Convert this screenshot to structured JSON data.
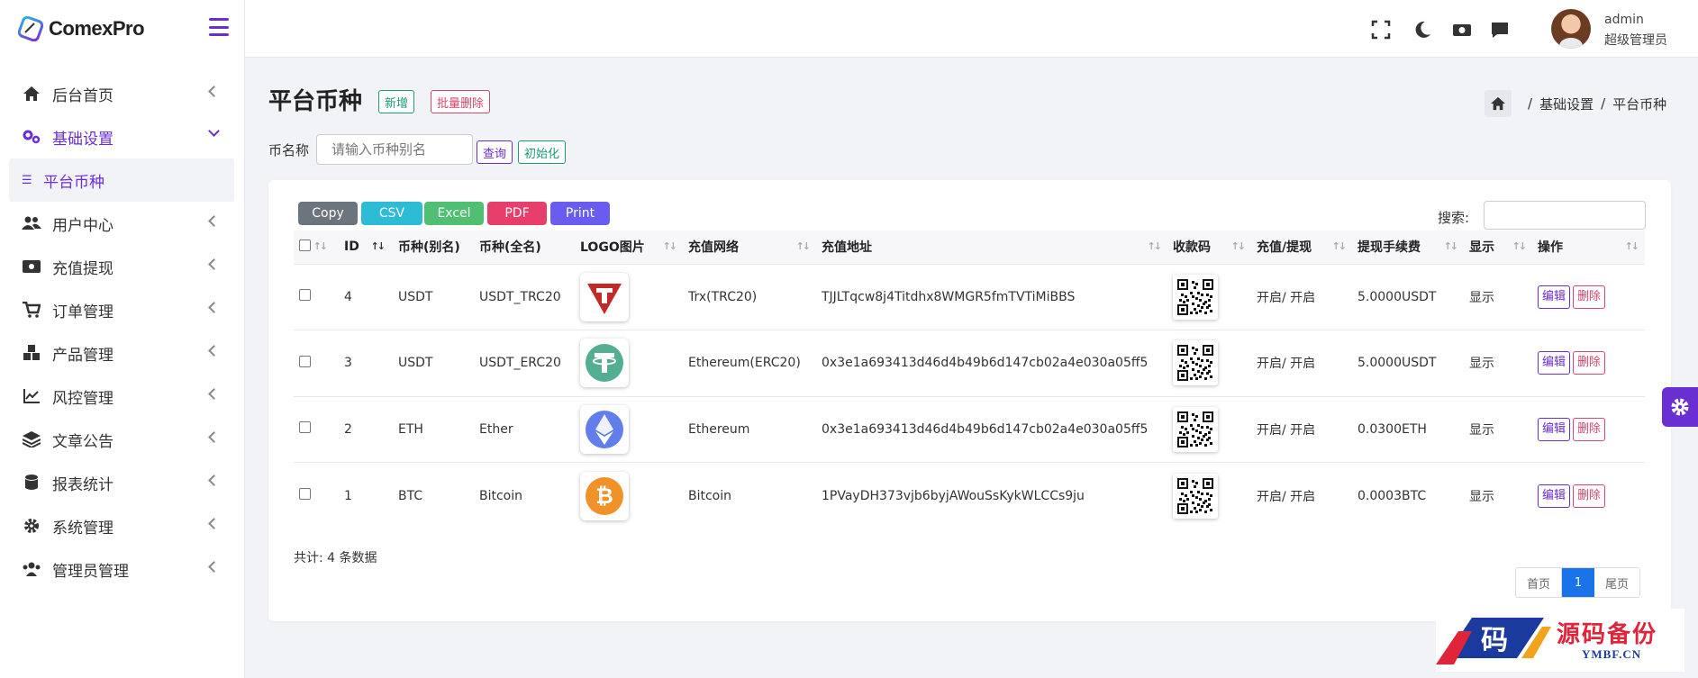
{
  "brand": {
    "name": "ComexPro"
  },
  "sidebar": {
    "items": [
      {
        "label": "后台首页",
        "icon": "home-icon"
      },
      {
        "label": "基础设置",
        "icon": "gears-icon"
      },
      {
        "label": "用户中心",
        "icon": "users-icon"
      },
      {
        "label": "充值提现",
        "icon": "money-icon"
      },
      {
        "label": "订单管理",
        "icon": "cart-icon"
      },
      {
        "label": "产品管理",
        "icon": "cubes-icon"
      },
      {
        "label": "风控管理",
        "icon": "chart-line-icon"
      },
      {
        "label": "文章公告",
        "icon": "layers-icon"
      },
      {
        "label": "报表统计",
        "icon": "database-icon"
      },
      {
        "label": "系统管理",
        "icon": "gear-icon"
      },
      {
        "label": "管理员管理",
        "icon": "user-group-icon"
      }
    ],
    "active_sub": "平台币种"
  },
  "topbar": {
    "user_name": "admin",
    "user_role": "超级管理员"
  },
  "page": {
    "title": "平台币种",
    "add_label": "新增",
    "bulk_delete_label": "批量删除",
    "breadcrumb": [
      "基础设置",
      "平台币种"
    ]
  },
  "filter": {
    "label": "币名称",
    "placeholder": "请输入币种别名",
    "search_label": "查询",
    "init_label": "初始化"
  },
  "exports": [
    {
      "label": "Copy",
      "color": "#6c757d"
    },
    {
      "label": "CSV",
      "color": "#2dbcd6"
    },
    {
      "label": "Excel",
      "color": "#4fbf72"
    },
    {
      "label": "PDF",
      "color": "#e83e6c"
    },
    {
      "label": "Print",
      "color": "#6a5cf0"
    }
  ],
  "table": {
    "search_label": "搜索:",
    "columns": [
      "ID",
      "币种(别名)",
      "币种(全名)",
      "LOGO图片",
      "充值网络",
      "充值地址",
      "收款码",
      "充值/提现",
      "提现手续费",
      "显示",
      "操作"
    ],
    "rows": [
      {
        "id": "4",
        "alias": "USDT",
        "full": "USDT_TRC20",
        "logo": "tron-usdt-icon",
        "network": "Trx(TRC20)",
        "address": "TJJLTqcw8j4Titdhx8WMGR5fmTVTiMiBBS",
        "status": "开启/ 开启",
        "fee": "5.0000USDT",
        "show": "显示"
      },
      {
        "id": "3",
        "alias": "USDT",
        "full": "USDT_ERC20",
        "logo": "tether-icon",
        "network": "Ethereum(ERC20)",
        "address": "0x3e1a693413d46d4b49b6d147cb02a4e030a05ff5",
        "status": "开启/ 开启",
        "fee": "5.0000USDT",
        "show": "显示"
      },
      {
        "id": "2",
        "alias": "ETH",
        "full": "Ether",
        "logo": "ethereum-icon",
        "network": "Ethereum",
        "address": "0x3e1a693413d46d4b49b6d147cb02a4e030a05ff5",
        "status": "开启/ 开启",
        "fee": "0.0300ETH",
        "show": "显示"
      },
      {
        "id": "1",
        "alias": "BTC",
        "full": "Bitcoin",
        "logo": "bitcoin-icon",
        "network": "Bitcoin",
        "address": "1PVayDH373vjb6byjAWouSsKykWLCCs9ju",
        "status": "开启/ 开启",
        "fee": "0.0003BTC",
        "show": "显示"
      }
    ],
    "edit_label": "编辑",
    "delete_label": "删除",
    "total_text": "共计: 4 条数据"
  },
  "pager": {
    "first": "首页",
    "current": "1",
    "last": "尾页"
  },
  "watermark": {
    "cn": "源码备份",
    "en": "YMBF.CN",
    "glyph": "码"
  },
  "colors": {
    "accent": "#6a2fd3",
    "success": "#1e9b78",
    "danger": "#d9466a",
    "primary": "#1a73e8"
  }
}
